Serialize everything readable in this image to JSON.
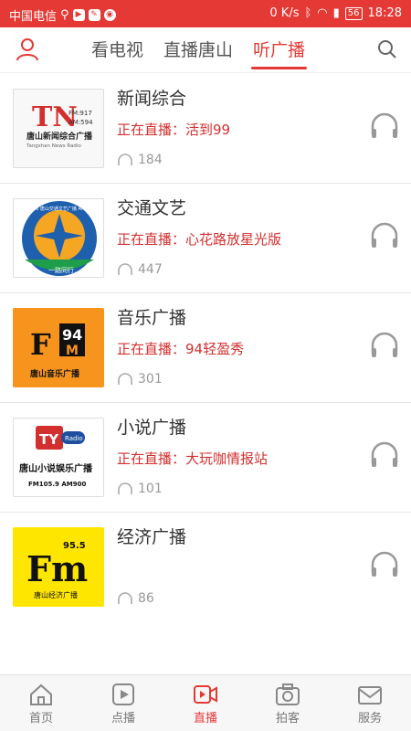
{
  "status_bar": {
    "carrier": "中国电信",
    "speed": "0 K/s",
    "battery": "56",
    "time": "18:28"
  },
  "top_nav": {
    "tabs": [
      {
        "label": "看电视",
        "active": false
      },
      {
        "label": "直播唐山",
        "active": false
      },
      {
        "label": "听广播",
        "active": true
      }
    ]
  },
  "stations": [
    {
      "name": "新闻综合",
      "now_playing": "正在直播：活到99",
      "listeners": "184",
      "logo": {
        "line1": "TN",
        "line2": "唐山新闻综合广播",
        "freq1": "FM:917",
        "freq2": "AM:594",
        "sub": "Tangshan News Radio"
      }
    },
    {
      "name": "交通文艺",
      "now_playing": "正在直播：心花路放星光版",
      "listeners": "447",
      "logo": {
        "arc": "FM99.6 唐山交通文艺广播 AM1143",
        "bottom": "一路同行"
      }
    },
    {
      "name": "音乐广播",
      "now_playing": "正在直播：94轻盈秀",
      "listeners": "301",
      "logo": {
        "freq": "94",
        "letter": "M",
        "text": "唐山音乐广播"
      }
    },
    {
      "name": "小说广播",
      "now_playing": "正在直播：大玩咖情报站",
      "listeners": "101",
      "logo": {
        "ty": "TY",
        "radio": "Radio",
        "text": "唐山小说娱乐广播",
        "freq": "FM105.9 AM900"
      }
    },
    {
      "name": "经济广播",
      "now_playing": "",
      "listeners": "86",
      "logo": {
        "fm": "Fm",
        "freq": "95.5",
        "text": "唐山经济广播"
      }
    }
  ],
  "bottom_nav": [
    {
      "label": "首页",
      "icon": "home-icon",
      "active": false
    },
    {
      "label": "点播",
      "icon": "play-icon",
      "active": false
    },
    {
      "label": "直播",
      "icon": "video-icon",
      "active": true
    },
    {
      "label": "拍客",
      "icon": "camera-icon",
      "active": false
    },
    {
      "label": "服务",
      "icon": "mail-icon",
      "active": false
    }
  ],
  "colors": {
    "accent": "#e53935",
    "live_text": "#d32f2f"
  }
}
